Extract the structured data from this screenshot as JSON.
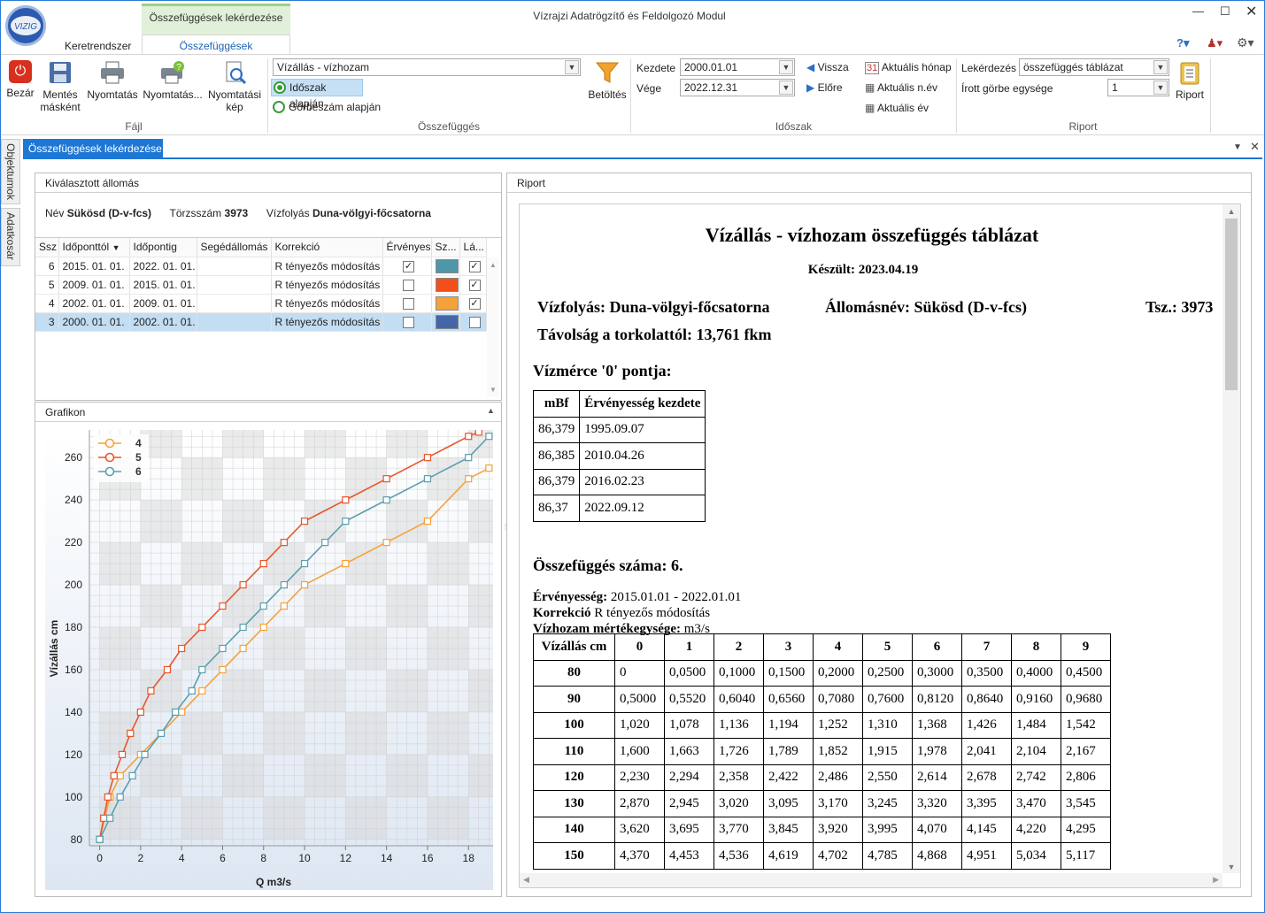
{
  "window": {
    "title": "Vízrajzi Adatrögzítő és Feldolgozó Modul",
    "context_tab": "Összefüggések lekérdezése",
    "tabs": [
      "Keretrendszer",
      "Összefüggések"
    ]
  },
  "ribbon": {
    "fajl": {
      "label": "Fájl",
      "buttons": [
        "Bezár",
        "Mentés másként",
        "Nyomtatás",
        "Nyomtatás...",
        "Nyomtatási kép"
      ]
    },
    "osszefugges": {
      "label": "Összefüggés",
      "type_value": "Vízállás - vízhozam",
      "radio1": "Időszak alapján",
      "radio2": "Görbeszám alapján",
      "load": "Betöltés"
    },
    "idoszak": {
      "label": "Időszak",
      "start_label": "Kezdete",
      "start_value": "2000.01.01",
      "end_label": "Vége",
      "end_value": "2022.12.31",
      "back": "Vissza",
      "forward": "Előre",
      "cur_month": "Aktuális hónap",
      "cur_quarter": "Aktuális n.év",
      "cur_year": "Aktuális év"
    },
    "riport": {
      "label": "Riport",
      "query_label": "Lekérdezés",
      "query_value": "összefüggés táblázat",
      "unit_label": "Írott görbe egysége",
      "unit_value": "1",
      "button": "Riport"
    }
  },
  "sidebar": {
    "tabs": [
      "Objektumok",
      "Adatkosár"
    ]
  },
  "doc_tab": "Összefüggések lekérdezése",
  "station": {
    "header": "Kiválasztott állomás",
    "name_label": "Név",
    "name": "Sükösd (D-v-fcs)",
    "id_label": "Törzsszám",
    "id": "3973",
    "river_label": "Vízfolyás",
    "river": "Duna-völgyi-főcsatorna"
  },
  "grid": {
    "columns": [
      "Ssz",
      "Időponttól",
      "Időpontig",
      "Segédállomás",
      "Korrekció",
      "Érvényes",
      "Sz...",
      "Lá..."
    ],
    "rows": [
      {
        "ssz": "6",
        "from": "2015. 01. 01.",
        "to": "2022. 01. 01.",
        "aux": "",
        "corr": "R tényezős módosítás",
        "valid": true,
        "color": "#4f97a8",
        "visible": true
      },
      {
        "ssz": "5",
        "from": "2009. 01. 01.",
        "to": "2015. 01. 01.",
        "aux": "",
        "corr": "R tényezős módosítás",
        "valid": false,
        "color": "#f2501a",
        "visible": true
      },
      {
        "ssz": "4",
        "from": "2002. 01. 01.",
        "to": "2009. 01. 01.",
        "aux": "",
        "corr": "R tényezős módosítás",
        "valid": false,
        "color": "#f5a23a",
        "visible": true
      },
      {
        "ssz": "3",
        "from": "2000. 01. 01.",
        "to": "2002. 01. 01.",
        "aux": "",
        "corr": "R tényezős módosítás",
        "valid": false,
        "color": "#4466a8",
        "visible": false
      }
    ]
  },
  "graph": {
    "header": "Grafikon"
  },
  "chart_data": {
    "type": "line",
    "xlabel": "Q m3/s",
    "ylabel": "Vízállás cm",
    "xlim": [
      -0.5,
      19.2
    ],
    "ylim": [
      77,
      273
    ],
    "xticks": [
      0,
      2,
      4,
      6,
      8,
      10,
      12,
      14,
      16,
      18
    ],
    "yticks": [
      80,
      100,
      120,
      140,
      160,
      180,
      200,
      220,
      240,
      260
    ],
    "legend": "top-left",
    "series": [
      {
        "name": "4",
        "color": "#f5a23a",
        "points": [
          [
            0,
            80
          ],
          [
            0.5,
            100
          ],
          [
            1,
            110
          ],
          [
            2,
            120
          ],
          [
            3,
            130
          ],
          [
            4,
            140
          ],
          [
            5,
            150
          ],
          [
            6,
            160
          ],
          [
            7,
            170
          ],
          [
            8,
            180
          ],
          [
            9,
            190
          ],
          [
            10,
            200
          ],
          [
            12,
            210
          ],
          [
            14,
            220
          ],
          [
            16,
            230
          ],
          [
            18,
            250
          ],
          [
            19,
            255
          ]
        ]
      },
      {
        "name": "5",
        "color": "#e8562a",
        "points": [
          [
            0,
            80
          ],
          [
            0.2,
            90
          ],
          [
            0.4,
            100
          ],
          [
            0.7,
            110
          ],
          [
            1.1,
            120
          ],
          [
            1.5,
            130
          ],
          [
            2,
            140
          ],
          [
            2.5,
            150
          ],
          [
            3.3,
            160
          ],
          [
            4,
            170
          ],
          [
            5,
            180
          ],
          [
            6,
            190
          ],
          [
            7,
            200
          ],
          [
            8,
            210
          ],
          [
            9,
            220
          ],
          [
            10,
            230
          ],
          [
            12,
            240
          ],
          [
            14,
            250
          ],
          [
            16,
            260
          ],
          [
            18,
            270
          ],
          [
            18.5,
            272
          ]
        ]
      },
      {
        "name": "6",
        "color": "#5a9fae",
        "points": [
          [
            0,
            80
          ],
          [
            0.5,
            90
          ],
          [
            1,
            100
          ],
          [
            1.6,
            110
          ],
          [
            2.2,
            120
          ],
          [
            3,
            130
          ],
          [
            3.7,
            140
          ],
          [
            4.5,
            150
          ],
          [
            5,
            160
          ],
          [
            6,
            170
          ],
          [
            7,
            180
          ],
          [
            8,
            190
          ],
          [
            9,
            200
          ],
          [
            10,
            210
          ],
          [
            11,
            220
          ],
          [
            12,
            230
          ],
          [
            14,
            240
          ],
          [
            16,
            250
          ],
          [
            18,
            260
          ],
          [
            19,
            270
          ]
        ]
      }
    ]
  },
  "report": {
    "panel_header": "Riport",
    "title": "Vízállás - vízhozam összefüggés táblázat",
    "created": "Készült: 2023.04.19",
    "river": "Vízfolyás: Duna-völgyi-főcsatorna",
    "station": "Állomásnév: Sükösd (D-v-fcs)",
    "tsz": "Tsz.: 3973",
    "distance": "Távolság a torkolattól: 13,761 fkm",
    "zero_title": "Vízmérce '0' pontja:",
    "zero_headers": [
      "mBf",
      "Érvényesség kezdete"
    ],
    "zero_rows": [
      [
        "86,379",
        "1995.09.07"
      ],
      [
        "86,385",
        "2010.04.26"
      ],
      [
        "86,379",
        "2016.02.23"
      ],
      [
        "86,37",
        "2022.09.12"
      ]
    ],
    "rel_title": "Összefüggés száma: 6.",
    "validity_label": "Érvényesség:",
    "validity": "2015.01.01 - 2022.01.01",
    "corr_label": "Korrekció",
    "corr": "R tényezős módosítás",
    "unit_label": "Vízhozam mértékegysége:",
    "unit": "m3/s",
    "table_headers": [
      "Vízállás cm",
      "0",
      "1",
      "2",
      "3",
      "4",
      "5",
      "6",
      "7",
      "8",
      "9"
    ],
    "table_rows": [
      [
        "80",
        "0",
        "0,0500",
        "0,1000",
        "0,1500",
        "0,2000",
        "0,2500",
        "0,3000",
        "0,3500",
        "0,4000",
        "0,4500"
      ],
      [
        "90",
        "0,5000",
        "0,5520",
        "0,6040",
        "0,6560",
        "0,7080",
        "0,7600",
        "0,8120",
        "0,8640",
        "0,9160",
        "0,9680"
      ],
      [
        "100",
        "1,020",
        "1,078",
        "1,136",
        "1,194",
        "1,252",
        "1,310",
        "1,368",
        "1,426",
        "1,484",
        "1,542"
      ],
      [
        "110",
        "1,600",
        "1,663",
        "1,726",
        "1,789",
        "1,852",
        "1,915",
        "1,978",
        "2,041",
        "2,104",
        "2,167"
      ],
      [
        "120",
        "2,230",
        "2,294",
        "2,358",
        "2,422",
        "2,486",
        "2,550",
        "2,614",
        "2,678",
        "2,742",
        "2,806"
      ],
      [
        "130",
        "2,870",
        "2,945",
        "3,020",
        "3,095",
        "3,170",
        "3,245",
        "3,320",
        "3,395",
        "3,470",
        "3,545"
      ],
      [
        "140",
        "3,620",
        "3,695",
        "3,770",
        "3,845",
        "3,920",
        "3,995",
        "4,070",
        "4,145",
        "4,220",
        "4,295"
      ],
      [
        "150",
        "4,370",
        "4,453",
        "4,536",
        "4,619",
        "4,702",
        "4,785",
        "4,868",
        "4,951",
        "5,034",
        "5,117"
      ]
    ]
  }
}
